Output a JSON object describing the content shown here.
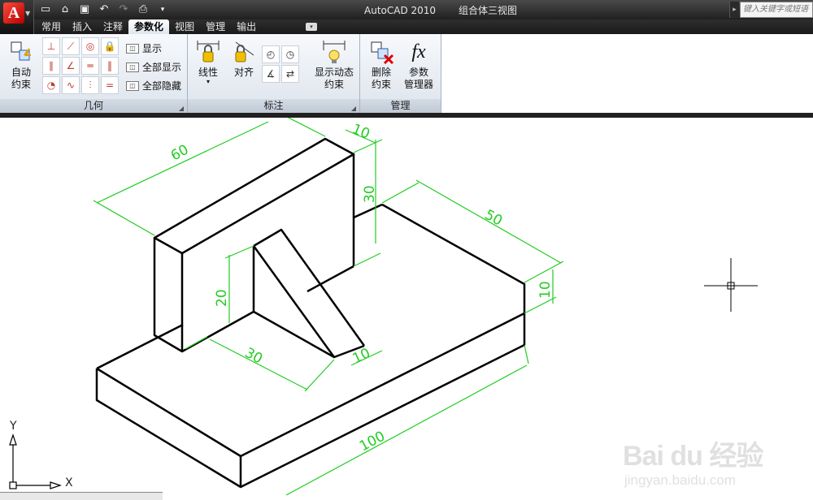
{
  "app": {
    "logo_letter": "A",
    "title": "AutoCAD 2010",
    "document": "组合体三视图",
    "search_placeholder": "键入关键字或短语"
  },
  "quick_access": [
    "new-icon",
    "open-icon",
    "save-icon",
    "undo-icon",
    "redo-icon",
    "plot-icon",
    "dropdown-icon"
  ],
  "tabs": [
    {
      "label": "常用"
    },
    {
      "label": "插入"
    },
    {
      "label": "注释"
    },
    {
      "label": "参数化",
      "active": true
    },
    {
      "label": "视图"
    },
    {
      "label": "管理"
    },
    {
      "label": "输出"
    }
  ],
  "ribbon": {
    "geometry": {
      "title": "几何",
      "auto_constrain": "自动\n约束",
      "show": "显示",
      "show_all": "全部显示",
      "hide_all": "全部隐藏"
    },
    "dimension": {
      "title": "标注",
      "linear": "线性",
      "aligned": "对齐",
      "show_dynamic": "显示动态\n约束"
    },
    "manage": {
      "title": "管理",
      "delete_constraints": "删除\n约束",
      "param_manager": "参数\n管理器",
      "fx_symbol": "fx"
    }
  },
  "drawing": {
    "dimensions": {
      "d60": "60",
      "d10_top": "10",
      "d30_vert": "30",
      "d50": "50",
      "d10_right": "10",
      "d20": "20",
      "d30_bottom": "30",
      "d10_rib": "10",
      "d100": "100"
    },
    "colors": {
      "dimension": "#22cc22",
      "geometry": "#000000"
    }
  },
  "ucs": {
    "x_label": "X",
    "y_label": "Y"
  },
  "watermark": {
    "brand": "Bai du 经验",
    "url": "jingyan.baidu.com"
  }
}
